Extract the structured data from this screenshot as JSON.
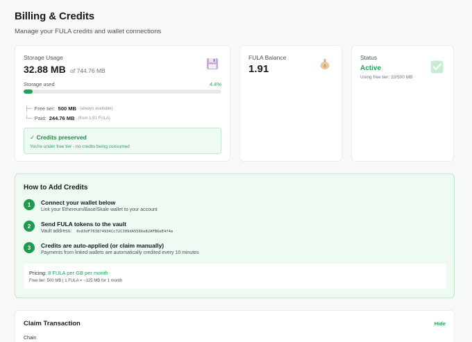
{
  "header": {
    "title": "Billing & Credits",
    "subtitle": "Manage your FULA credits and wallet connections"
  },
  "storage": {
    "label": "Storage Usage",
    "used": "32.88 MB",
    "of_total": "of 744.76 MB",
    "used_label": "Storage used",
    "used_percent_text": "4.4%",
    "used_fraction": 0.044,
    "icon": "floppy-disk-icon",
    "tiers": [
      {
        "connector": "├─",
        "key": "Free tier:",
        "value": "500 MB",
        "note": "(always available)"
      },
      {
        "connector": "└─",
        "key": "Paid:",
        "value": "244.76 MB",
        "note": "(from 1.91 FULA)"
      }
    ],
    "preserved": {
      "title": "✓ Credits preserved",
      "text": "You're under free tier - no credits being consumed"
    }
  },
  "fula": {
    "label": "FULA Balance",
    "value": "1.91",
    "icon": "money-bag-icon"
  },
  "status": {
    "label": "Status",
    "value": "Active",
    "note": "Using free tier: 33/500 MB",
    "icon": "check-box-icon"
  },
  "howto": {
    "title": "How to Add Credits",
    "steps": [
      {
        "num": "1",
        "title": "Connect your wallet below",
        "desc": "Link your Ethereum/Base/Skale wallet to your account"
      },
      {
        "num": "2",
        "title": "Send FULA tokens to the vault",
        "desc": "Vault address:",
        "address": "0x83dF763874934Cc72C309dA5566e82AFB6eE4f4e"
      },
      {
        "num": "3",
        "title": "Credits are auto-applied (or claim manually)",
        "desc": "Payments from linked wallets are automatically credited every 10 minutes"
      }
    ],
    "pricing": {
      "label": "Pricing:",
      "value": "8 FULA per GB per month",
      "sub": "Free tier: 500 MB | 1 FULA = ~125 MB for 1 month"
    }
  },
  "claim": {
    "title": "Claim Transaction",
    "hide_label": "Hide",
    "chain_label": "Chain"
  },
  "colors": {
    "accent": "#22a257",
    "accent_bg": "#eefaf2",
    "accent_border": "#bfe8cd"
  }
}
